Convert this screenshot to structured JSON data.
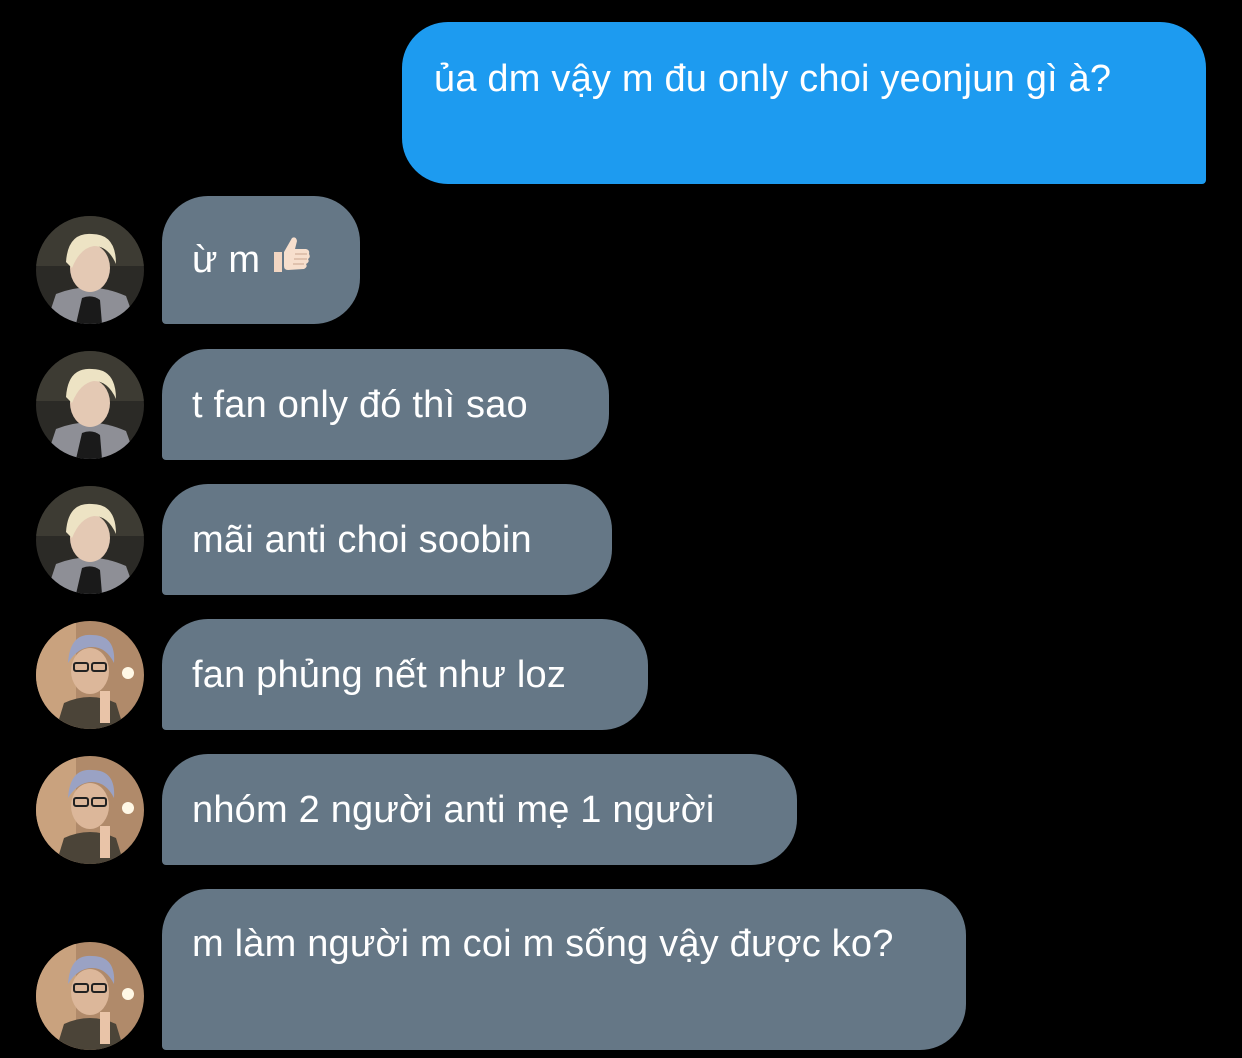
{
  "conversation": {
    "outgoing": [
      {
        "text": "ủa dm vậy m đu only choi yeonjun gì à?"
      }
    ],
    "incoming": [
      {
        "text": "ừ m",
        "icon": "thumbs-up-emoji",
        "avatar": "avatar-blonde"
      },
      {
        "text": "t fan only đó thì sao",
        "avatar": "avatar-blonde"
      },
      {
        "text": "mãi anti choi soobin",
        "avatar": "avatar-blonde"
      },
      {
        "text": "fan phủng nết như loz",
        "avatar": "avatar-silver-glasses"
      },
      {
        "text": "nhóm 2 người anti mẹ 1 người",
        "avatar": "avatar-silver-glasses"
      },
      {
        "text": "m làm người m coi m sống vậy được ko?",
        "avatar": "avatar-silver-glasses"
      }
    ]
  },
  "colors": {
    "background": "#000000",
    "outgoing_bubble": "#1d9bf0",
    "incoming_bubble": "#657786",
    "text": "#ffffff"
  }
}
